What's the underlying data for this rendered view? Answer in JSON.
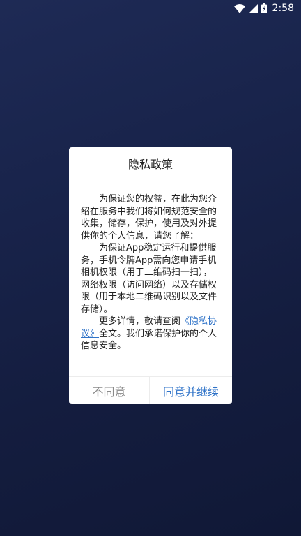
{
  "status_bar": {
    "time": "2:58",
    "icons": [
      "wifi-icon",
      "signal-icon",
      "battery-icon"
    ],
    "text_color": "#ffffff"
  },
  "dialog": {
    "title": "隐私政策",
    "paragraphs": {
      "p1": "为保证您的权益，在此为您介绍在服务中我们将如何规范安全的收集，储存，保护，使用及对外提供你的个人信息，请您了解：",
      "p2": "为保证App稳定运行和提供服务，手机令牌App需向您申请手机相机权限（用于二维码扫一扫），网络权限（访问网络）以及存储权限（用于本地二维码识别以及文件存储）。",
      "p3_before_link": "更多详情，敬请查阅",
      "p3_link": "《隐私协议》",
      "p3_after_link": "全文。我们承诺保护你的个人信息安全。"
    },
    "buttons": {
      "disagree": "不同意",
      "agree": "同意并继续"
    }
  },
  "colors": {
    "background": "#18234a",
    "accent": "#2f73c8",
    "disagree_text": "#8a8a8a"
  }
}
